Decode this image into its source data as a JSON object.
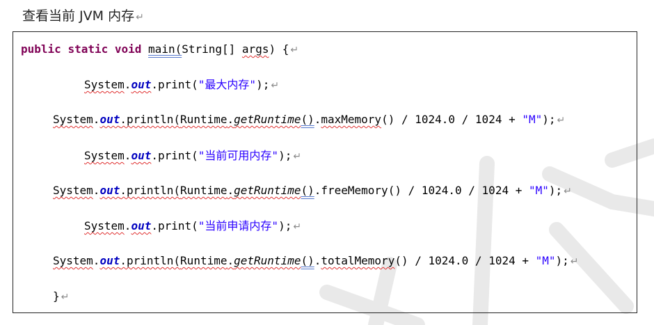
{
  "heading": {
    "text": "查看当前 JVM 内存",
    "mark": "↵"
  },
  "code": {
    "signature": {
      "kw_public": "public",
      "kw_static": "static",
      "kw_void": "void",
      "method": "main",
      "paren_open": "(",
      "param_type": "String[] ",
      "param_name": "args",
      "tail": ") {"
    },
    "sys": "System",
    "dot": ".",
    "out": "out",
    "print": ".print(",
    "println": ".println(",
    "runtime": "Runtime",
    "get_runtime": "getRuntime",
    "parens": "()",
    "close": ");",
    "division": "() / 1024.0 / 1024 + ",
    "str_max": "\"最大内存\"",
    "str_free": "\"当前可用内存\"",
    "str_total": "\"当前申请内存\"",
    "max_method": "maxMemory",
    "free_method": "freeMemory",
    "total_method": "totalMemory",
    "m_str": "\"M\"",
    "end_brace": "}",
    "mark": "↵"
  }
}
